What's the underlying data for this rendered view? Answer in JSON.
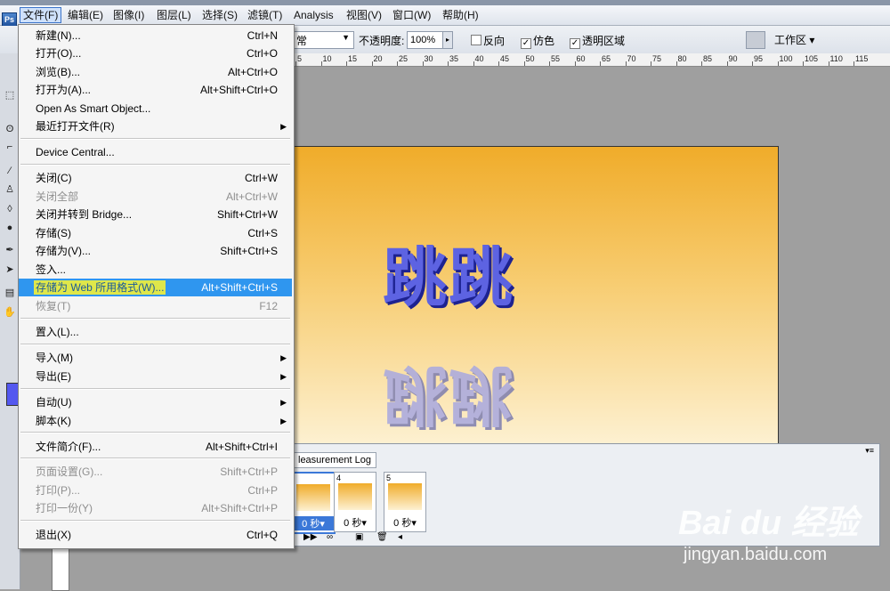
{
  "menubar": {
    "items": [
      "文件(F)",
      "编辑(E)",
      "图像(I)",
      "图层(L)",
      "选择(S)",
      "滤镜(T)",
      "Analysis",
      "视图(V)",
      "窗口(W)",
      "帮助(H)"
    ],
    "logo": "Ps"
  },
  "options": {
    "mode_value": "常",
    "opacity_label": "不透明度:",
    "opacity_value": "100%",
    "reverse_label": "反向",
    "dither_label": "仿色",
    "transparency_label": "透明区域",
    "workspace_label": "工作区 ▾"
  },
  "ruler": {
    "ticks": [
      "5",
      "10",
      "15",
      "20",
      "25",
      "30",
      "35",
      "40",
      "45",
      "50",
      "55",
      "60",
      "65",
      "70",
      "75",
      "80",
      "85",
      "90",
      "95",
      "100",
      "105",
      "110",
      "115"
    ]
  },
  "canvas": {
    "text": "跳跳",
    "reflection_text": "跳跳",
    "accent": "#5d63e2"
  },
  "animation": {
    "tab_label": "leasurement Log",
    "frames": [
      {
        "num": "",
        "delay": "0 秒▾"
      },
      {
        "num": "4",
        "delay": "0 秒▾"
      },
      {
        "num": "5",
        "delay": "0 秒▾"
      }
    ]
  },
  "file_menu": {
    "items": [
      {
        "label": "新建(N)...",
        "shortcut": "Ctrl+N",
        "disabled": false
      },
      {
        "label": "打开(O)...",
        "shortcut": "Ctrl+O",
        "disabled": false
      },
      {
        "label": "浏览(B)...",
        "shortcut": "Alt+Ctrl+O",
        "disabled": false
      },
      {
        "label": "打开为(A)...",
        "shortcut": "Alt+Shift+Ctrl+O",
        "disabled": false
      },
      {
        "label": "Open As Smart Object...",
        "shortcut": "",
        "disabled": false
      },
      {
        "label": "最近打开文件(R)",
        "shortcut": "",
        "disabled": false,
        "submenu": true
      },
      {
        "label": "Device Central...",
        "shortcut": "",
        "disabled": false
      },
      {
        "label": "关闭(C)",
        "shortcut": "Ctrl+W",
        "disabled": false
      },
      {
        "label": "关闭全部",
        "shortcut": "Alt+Ctrl+W",
        "disabled": true
      },
      {
        "label": "关闭并转到 Bridge...",
        "shortcut": "Shift+Ctrl+W",
        "disabled": false
      },
      {
        "label": "存储(S)",
        "shortcut": "Ctrl+S",
        "disabled": false
      },
      {
        "label": "存储为(V)...",
        "shortcut": "Shift+Ctrl+S",
        "disabled": false
      },
      {
        "label": "签入...",
        "shortcut": "",
        "disabled": false
      },
      {
        "label": "存储为 Web 所用格式(W)...",
        "shortcut": "Alt+Shift+Ctrl+S",
        "disabled": false,
        "highlighted": true
      },
      {
        "label": "恢复(T)",
        "shortcut": "F12",
        "disabled": true
      },
      {
        "label": "置入(L)...",
        "shortcut": "",
        "disabled": false
      },
      {
        "label": "导入(M)",
        "shortcut": "",
        "disabled": false,
        "submenu": true
      },
      {
        "label": "导出(E)",
        "shortcut": "",
        "disabled": false,
        "submenu": true
      },
      {
        "label": "自动(U)",
        "shortcut": "",
        "disabled": false,
        "submenu": true
      },
      {
        "label": "脚本(K)",
        "shortcut": "",
        "disabled": false,
        "submenu": true
      },
      {
        "label": "文件简介(F)...",
        "shortcut": "Alt+Shift+Ctrl+I",
        "disabled": false
      },
      {
        "label": "页面设置(G)...",
        "shortcut": "Shift+Ctrl+P",
        "disabled": true
      },
      {
        "label": "打印(P)...",
        "shortcut": "Ctrl+P",
        "disabled": true
      },
      {
        "label": "打印一份(Y)",
        "shortcut": "Alt+Shift+Ctrl+P",
        "disabled": true
      },
      {
        "label": "退出(X)",
        "shortcut": "Ctrl+Q",
        "disabled": false
      }
    ]
  },
  "watermark": {
    "logo": "Bai du 经验",
    "url": "jingyan.baidu.com"
  }
}
